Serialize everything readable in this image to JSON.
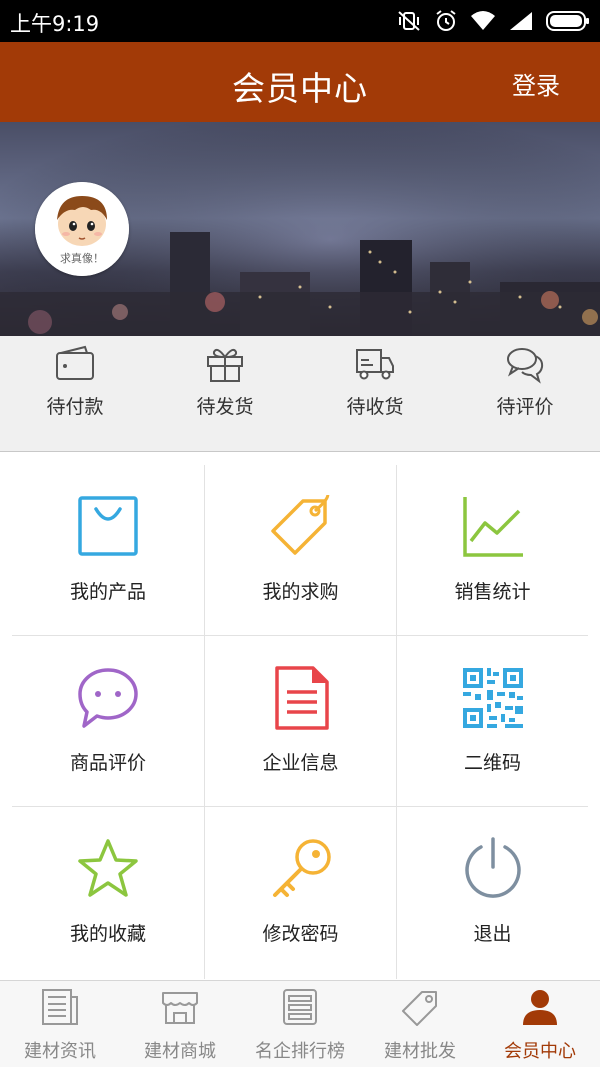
{
  "status_bar": {
    "time": "上午9:19",
    "icons": [
      "vibrate-icon",
      "alarm-icon",
      "wifi-icon",
      "signal-icon",
      "battery-icon"
    ]
  },
  "header": {
    "title": "会员中心",
    "login_label": "登录",
    "background_color": "#a23a07"
  },
  "profile": {
    "avatar_caption": "求真像！"
  },
  "order_status": [
    {
      "label": "待付款",
      "icon": "wallet-icon"
    },
    {
      "label": "待发货",
      "icon": "gift-icon"
    },
    {
      "label": "待收货",
      "icon": "truck-icon"
    },
    {
      "label": "待评价",
      "icon": "chat-bubbles-icon"
    }
  ],
  "features": [
    {
      "label": "我的产品",
      "icon": "shopping-bag-icon",
      "color": "#35a8e0"
    },
    {
      "label": "我的求购",
      "icon": "price-tag-icon",
      "color": "#f5b335"
    },
    {
      "label": "销售统计",
      "icon": "line-chart-icon",
      "color": "#8cc63f"
    },
    {
      "label": "商品评价",
      "icon": "speech-bubble-icon",
      "color": "#a066c8"
    },
    {
      "label": "企业信息",
      "icon": "document-icon",
      "color": "#e8454a"
    },
    {
      "label": "二维码",
      "icon": "qr-code-icon",
      "color": "#35a8e0"
    },
    {
      "label": "我的收藏",
      "icon": "star-icon",
      "color": "#8cc63f"
    },
    {
      "label": "修改密码",
      "icon": "key-icon",
      "color": "#f5b335"
    },
    {
      "label": "退出",
      "icon": "power-icon",
      "color": "#7e8fa0"
    }
  ],
  "bottom_nav": [
    {
      "label": "建材资讯",
      "icon": "news-icon",
      "active": false
    },
    {
      "label": "建材商城",
      "icon": "store-icon",
      "active": false
    },
    {
      "label": "名企排行榜",
      "icon": "ranking-list-icon",
      "active": false
    },
    {
      "label": "建材批发",
      "icon": "tag-icon",
      "active": false
    },
    {
      "label": "会员中心",
      "icon": "user-icon",
      "active": true
    }
  ]
}
